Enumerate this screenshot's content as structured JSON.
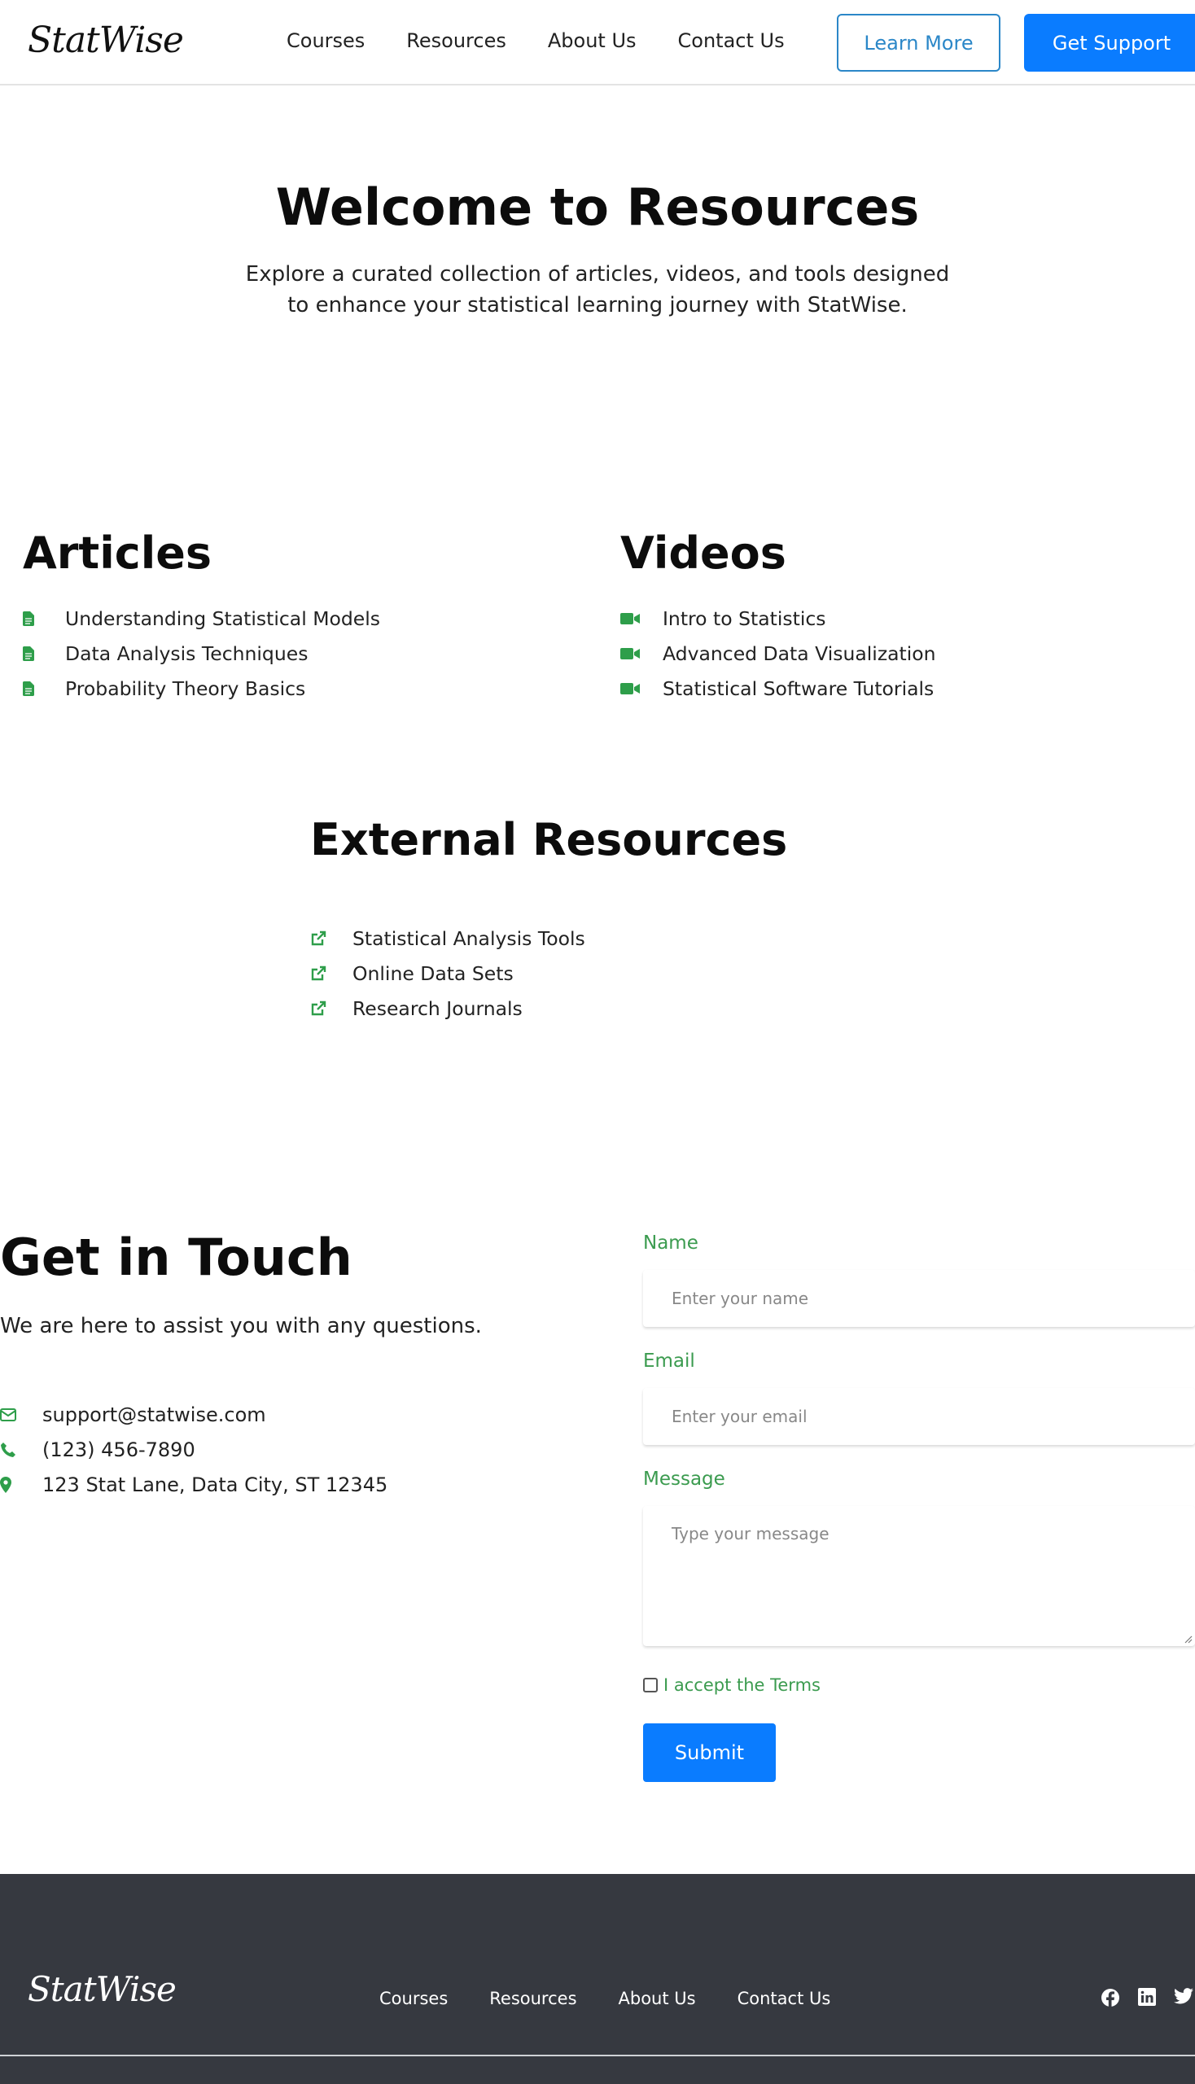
{
  "header": {
    "logo": "StatWise",
    "nav": [
      "Courses",
      "Resources",
      "About Us",
      "Contact Us"
    ],
    "learn_more": "Learn More",
    "get_support": "Get Support"
  },
  "hero": {
    "title": "Welcome to Resources",
    "subtitle_line1": "Explore a curated collection of articles, videos, and tools designed",
    "subtitle_line2": "to enhance your statistical learning journey with StatWise."
  },
  "articles": {
    "title": "Articles",
    "items": [
      "Understanding Statistical Models",
      "Data Analysis Techniques",
      "Probability Theory Basics"
    ]
  },
  "videos": {
    "title": "Videos",
    "items": [
      "Intro to Statistics",
      "Advanced Data Visualization",
      "Statistical Software Tutorials"
    ]
  },
  "external": {
    "title": "External Resources",
    "items": [
      "Statistical Analysis Tools",
      "Online Data Sets",
      "Research Journals"
    ]
  },
  "contact": {
    "title": "Get in Touch",
    "subtitle": "We are here to assist you with any questions.",
    "email": "support@statwise.com",
    "phone": "(123) 456-7890",
    "address": "123 Stat Lane, Data City, ST 12345"
  },
  "form": {
    "name_label": "Name",
    "name_placeholder": "Enter your name",
    "email_label": "Email",
    "email_placeholder": "Enter your email",
    "message_label": "Message",
    "message_placeholder": "Type your message",
    "terms_label": "I accept the Terms",
    "submit": "Submit"
  },
  "footer": {
    "logo": "StatWise",
    "nav": [
      "Courses",
      "Resources",
      "About Us",
      "Contact Us"
    ],
    "social": [
      "facebook-icon",
      "linkedin-icon",
      "twitter-icon"
    ]
  },
  "colors": {
    "accent_blue": "#0a7cff",
    "accent_green": "#2e9e4a",
    "footer_bg": "#363940"
  }
}
